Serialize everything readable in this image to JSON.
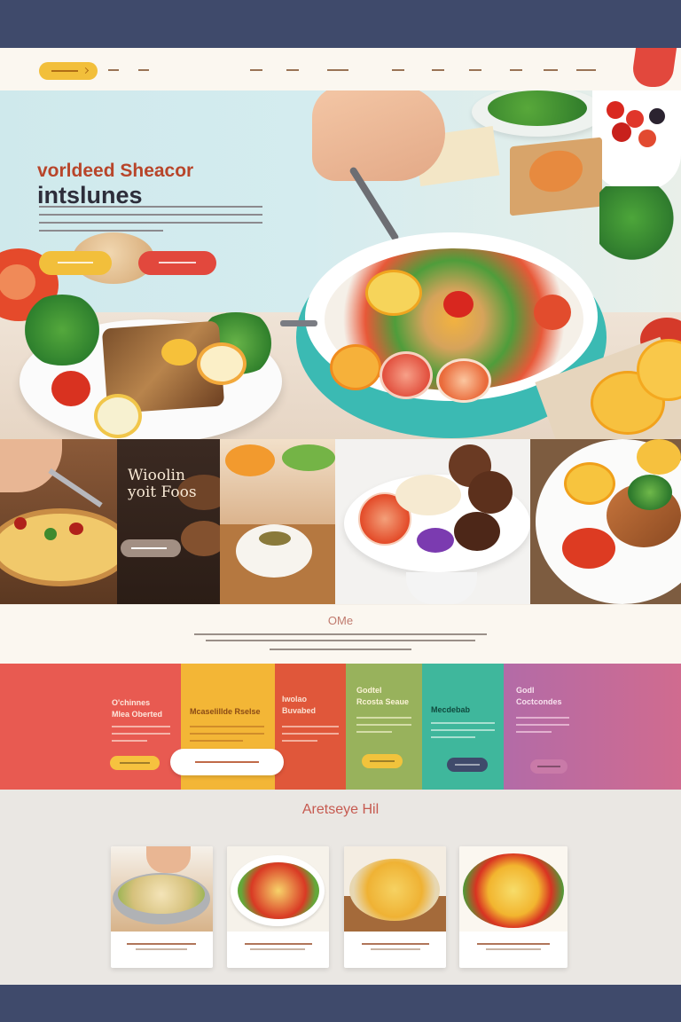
{
  "hero": {
    "title_line1": "vorldeed Sheacor",
    "title_line2": "intslunes"
  },
  "gallery": {
    "overlay_line1": "Wioolin",
    "overlay_line2": "yoit Foos"
  },
  "intro": {
    "title": "OMe"
  },
  "strips": [
    {
      "line1": "O'chinnes",
      "line2": "Mlea Oberted"
    },
    {
      "line1": "Mcaselillde Rselse",
      "line2": ""
    },
    {
      "line1": "Iwolao",
      "line2": "Buvabed"
    },
    {
      "line1": "Godtel",
      "line2": "Rcosta Seaue"
    },
    {
      "line1": "Mecdebab",
      "line2": ""
    },
    {
      "line1": "Godl",
      "line2": "Coctcondes"
    }
  ],
  "cards": {
    "title": "Aretseye Hil"
  },
  "colors": {
    "accent_red": "#e2483d",
    "accent_yellow": "#f2bf3b",
    "nav_bg": "#fbf7f0",
    "frame_bg": "#3f4a6b"
  },
  "icons": {
    "nav_dropdown": "chevron-down-icon"
  }
}
